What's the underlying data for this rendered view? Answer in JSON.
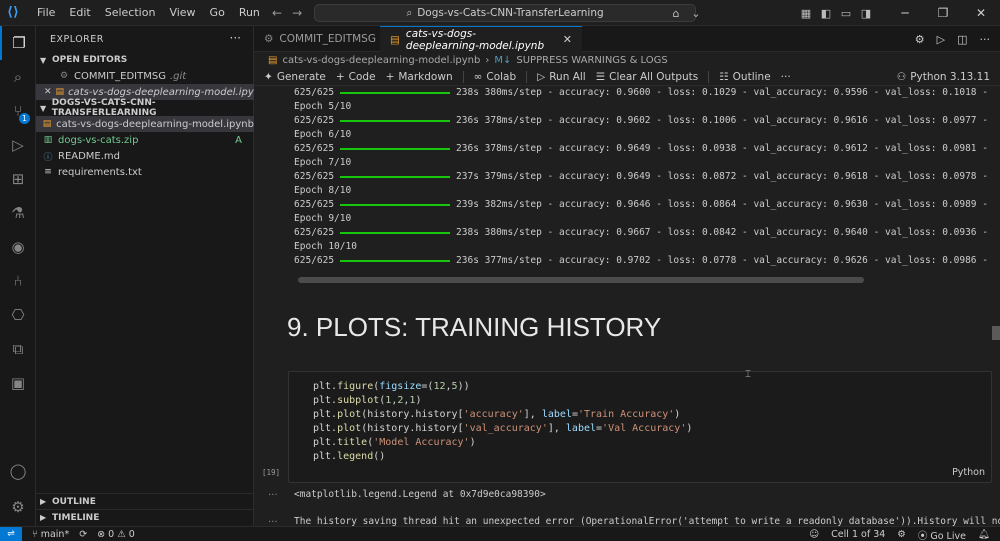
{
  "menu": [
    "File",
    "Edit",
    "Selection",
    "View",
    "Go",
    "Run"
  ],
  "search": {
    "text": "Dogs-vs-Cats-CNN-TransferLearning"
  },
  "sidebar": {
    "title": "EXPLORER",
    "open_editors_title": "OPEN EDITORS",
    "open_editors": [
      {
        "name": "COMMIT_EDITMSG",
        "hint": ".git"
      },
      {
        "name": "cats-vs-dogs-deeplearning-model.ipynb"
      }
    ],
    "project_title": "DOGS-VS-CATS-CNN-TRANSFERLEARNING",
    "files": [
      {
        "name": "cats-vs-dogs-deeplearning-model.ipynb",
        "status": ""
      },
      {
        "name": "dogs-vs-cats.zip",
        "status": "A"
      },
      {
        "name": "README.md",
        "status": ""
      },
      {
        "name": "requirements.txt",
        "status": ""
      }
    ],
    "outline": "OUTLINE",
    "timeline": "TIMELINE"
  },
  "tabs": [
    {
      "label": "COMMIT_EDITMSG"
    },
    {
      "label": "cats-vs-dogs-deeplearning-model.ipynb"
    }
  ],
  "breadcrumb": {
    "file": "cats-vs-dogs-deeplearning-model.ipynb",
    "section": "SUPPRESS WARNINGS & LOGS"
  },
  "toolbar": {
    "generate": "Generate",
    "code": "Code",
    "markdown": "Markdown",
    "colab": "Colab",
    "run_all": "Run All",
    "clear_outputs": "Clear All Outputs",
    "outline": "Outline",
    "kernel": "Python 3.13.11"
  },
  "output_lines": [
    "625/625 ━━━ 238s 380ms/step - accuracy: 0.9600 - loss: 0.1029 - val_accuracy: 0.9596 - val_loss: 0.1018 -",
    "Epoch 5/10",
    "625/625 ━━━ 236s 378ms/step - accuracy: 0.9602 - loss: 0.1006 - val_accuracy: 0.9616 - val_loss: 0.0977 -",
    "Epoch 6/10",
    "625/625 ━━━ 236s 378ms/step - accuracy: 0.9649 - loss: 0.0938 - val_accuracy: 0.9612 - val_loss: 0.0981 -",
    "Epoch 7/10",
    "625/625 ━━━ 237s 379ms/step - accuracy: 0.9649 - loss: 0.0872 - val_accuracy: 0.9618 - val_loss: 0.0978 -",
    "Epoch 8/10",
    "625/625 ━━━ 239s 382ms/step - accuracy: 0.9646 - loss: 0.0864 - val_accuracy: 0.9630 - val_loss: 0.0989 -",
    "Epoch 9/10",
    "625/625 ━━━ 238s 380ms/step - accuracy: 0.9667 - loss: 0.0842 - val_accuracy: 0.9640 - val_loss: 0.0936 -",
    "Epoch 10/10",
    "625/625 ━━━ 236s 377ms/step - accuracy: 0.9702 - loss: 0.0778 - val_accuracy: 0.9626 - val_loss: 0.0986 -"
  ],
  "progress": [
    {
      "step": "625/625",
      "rest": "238s 380ms/step - accuracy: 0.9600 - loss: 0.1029 - val_accuracy: 0.9596 - val_loss: 0.1018 -"
    },
    {
      "epoch": "Epoch 5/10"
    },
    {
      "step": "625/625",
      "rest": "236s 378ms/step - accuracy: 0.9602 - loss: 0.1006 - val_accuracy: 0.9616 - val_loss: 0.0977 -"
    },
    {
      "epoch": "Epoch 6/10"
    },
    {
      "step": "625/625",
      "rest": "236s 378ms/step - accuracy: 0.9649 - loss: 0.0938 - val_accuracy: 0.9612 - val_loss: 0.0981 -"
    },
    {
      "epoch": "Epoch 7/10"
    },
    {
      "step": "625/625",
      "rest": "237s 379ms/step - accuracy: 0.9649 - loss: 0.0872 - val_accuracy: 0.9618 - val_loss: 0.0978 -"
    },
    {
      "epoch": "Epoch 8/10"
    },
    {
      "step": "625/625",
      "rest": "239s 382ms/step - accuracy: 0.9646 - loss: 0.0864 - val_accuracy: 0.9630 - val_loss: 0.0989 -"
    },
    {
      "epoch": "Epoch 9/10"
    },
    {
      "step": "625/625",
      "rest": "238s 380ms/step - accuracy: 0.9667 - loss: 0.0842 - val_accuracy: 0.9640 - val_loss: 0.0936 -"
    },
    {
      "epoch": "Epoch 10/10"
    },
    {
      "step": "625/625",
      "rest": "236s 377ms/step - accuracy: 0.9702 - loss: 0.0778 - val_accuracy: 0.9626 - val_loss: 0.0986 -"
    }
  ],
  "heading": "9. PLOTS: TRAINING HISTORY",
  "cell": {
    "exec_count": "[19]",
    "language": "Python",
    "output1": "<matplotlib.legend.Legend at 0x7d9e0ca98390>",
    "output2": "The history saving thread hit an unexpected error (OperationalError('attempt to write a readonly database')).History will no"
  },
  "status": {
    "branch": "main*",
    "errors": "0",
    "warnings": "0",
    "cell": "Cell 1 of 34",
    "golive": "Go Live"
  },
  "colors": {
    "accent": "#0078d4",
    "progress": "#16c60c",
    "background": "#1f1f1f"
  }
}
